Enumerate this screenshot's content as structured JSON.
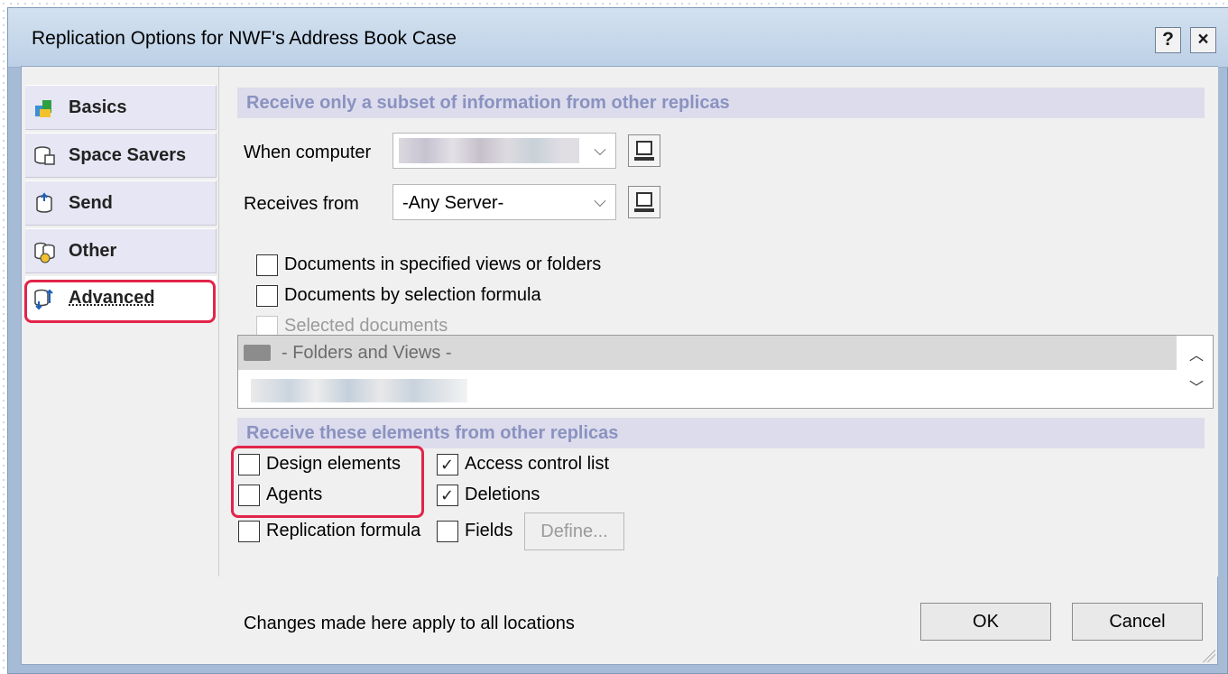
{
  "window": {
    "title": "Replication Options for NWF's Address Book Case",
    "help_label": "?",
    "close_label": "×"
  },
  "tabs": [
    {
      "label": "Basics",
      "icon": "basics-icon"
    },
    {
      "label": "Space Savers",
      "icon": "space-savers-icon"
    },
    {
      "label": "Send",
      "icon": "send-icon"
    },
    {
      "label": "Other",
      "icon": "other-icon"
    },
    {
      "label": "Advanced",
      "icon": "advanced-icon",
      "active": true
    }
  ],
  "subset_section": {
    "header": "Receive only a subset of information from other replicas",
    "when_computer_label": "When computer",
    "when_computer_value": "",
    "receives_from_label": "Receives from",
    "receives_from_value": "-Any Server-",
    "options": [
      {
        "label": "Documents in specified views or folders",
        "checked": false,
        "enabled": true
      },
      {
        "label": "Documents by selection formula",
        "checked": false,
        "enabled": true
      },
      {
        "label": "Selected documents",
        "checked": false,
        "enabled": false
      }
    ],
    "list_header": "- Folders and Views -"
  },
  "elements_section": {
    "header": "Receive these elements from other replicas",
    "design_elements": {
      "label": "Design elements",
      "checked": false
    },
    "agents": {
      "label": "Agents",
      "checked": false
    },
    "replication_formula": {
      "label": "Replication formula",
      "checked": false
    },
    "access_control_list": {
      "label": "Access control list",
      "checked": true
    },
    "deletions": {
      "label": "Deletions",
      "checked": true
    },
    "fields": {
      "label": "Fields",
      "checked": false
    },
    "define_label": "Define..."
  },
  "footer": {
    "note": "Changes made here apply to all locations",
    "ok_label": "OK",
    "cancel_label": "Cancel"
  },
  "highlight_color": "#e2244a"
}
